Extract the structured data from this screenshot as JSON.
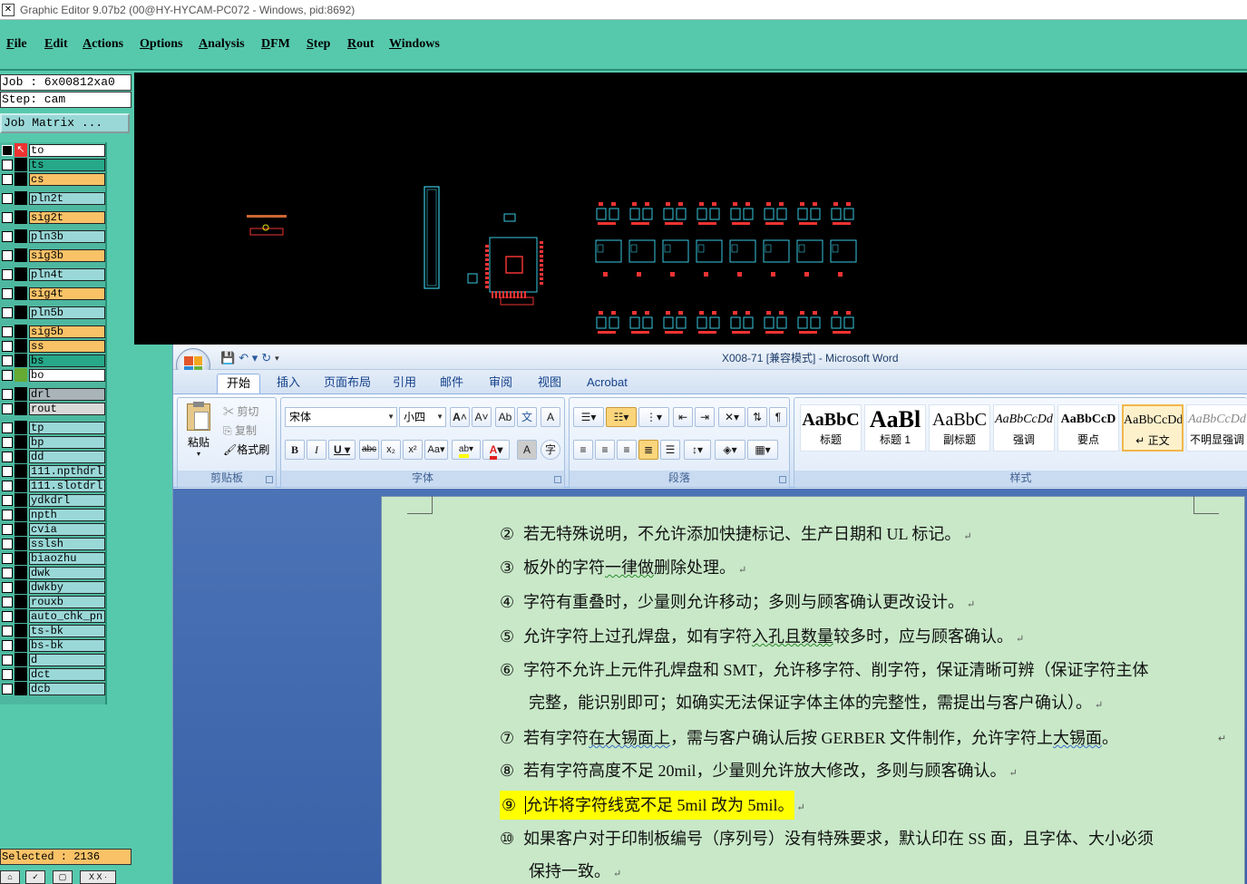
{
  "genesis": {
    "title": "Graphic Editor 9.07b2 (00@HY-HYCAM-PC072 - Windows, pid:8692)",
    "menu": [
      {
        "label": "File",
        "u": "F",
        "rest": "ile"
      },
      {
        "label": "Edit",
        "u": "E",
        "rest": "dit"
      },
      {
        "label": "Actions",
        "u": "A",
        "rest": "ctions"
      },
      {
        "label": "Options",
        "u": "O",
        "rest": "ptions"
      },
      {
        "label": "Analysis",
        "u": "A",
        "rest": "nalysis"
      },
      {
        "label": "DFM",
        "u": "D",
        "rest": "FM"
      },
      {
        "label": "Step",
        "u": "S",
        "rest": "tep"
      },
      {
        "label": "Rout",
        "u": "R",
        "rest": "out"
      },
      {
        "label": "Windows",
        "u": "W",
        "rest": "indows"
      }
    ],
    "job": "Job : 6x00812xa0",
    "step": "Step: cam",
    "job_matrix": "Job Matrix ...",
    "selected": "Selected : 2136",
    "layers": [
      {
        "name": "to",
        "color": "#ffffff"
      },
      {
        "name": "ts",
        "color": "#26a889"
      },
      {
        "name": "cs",
        "color": "#f9c267"
      },
      {
        "name": "pln2t",
        "color": "#9ad8d8"
      },
      {
        "name": "sig2t",
        "color": "#f9c267"
      },
      {
        "name": "pln3b",
        "color": "#9ad8d8"
      },
      {
        "name": "sig3b",
        "color": "#f9c267"
      },
      {
        "name": "pln4t",
        "color": "#9ad8d8"
      },
      {
        "name": "sig4t",
        "color": "#f9c267"
      },
      {
        "name": "pln5b",
        "color": "#9ad8d8"
      },
      {
        "name": "sig5b",
        "color": "#f9c267"
      },
      {
        "name": "ss",
        "color": "#f9c267"
      },
      {
        "name": "bs",
        "color": "#26a889"
      },
      {
        "name": "bo",
        "color": "#ffffff"
      },
      {
        "name": "drl",
        "color": "#a8b4b8"
      },
      {
        "name": "rout",
        "color": "#d9d9d9"
      },
      {
        "name": "tp",
        "color": "#9ad8d8"
      },
      {
        "name": "bp",
        "color": "#9ad8d8"
      },
      {
        "name": "dd",
        "color": "#9ad8d8"
      },
      {
        "name": "111.npthdrl",
        "color": "#9ad8d8"
      },
      {
        "name": "111.slotdrl",
        "color": "#9ad8d8"
      },
      {
        "name": "ydkdrl",
        "color": "#9ad8d8"
      },
      {
        "name": "npth",
        "color": "#9ad8d8"
      },
      {
        "name": "cvia",
        "color": "#9ad8d8"
      },
      {
        "name": "sslsh",
        "color": "#9ad8d8"
      },
      {
        "name": "biaozhu",
        "color": "#9ad8d8"
      },
      {
        "name": "dwk",
        "color": "#9ad8d8"
      },
      {
        "name": "dwkby",
        "color": "#9ad8d8"
      },
      {
        "name": "rouxb",
        "color": "#9ad8d8"
      },
      {
        "name": "auto_chk_pn",
        "color": "#9ad8d8"
      },
      {
        "name": "ts-bk",
        "color": "#9ad8d8"
      },
      {
        "name": "bs-bk",
        "color": "#9ad8d8"
      },
      {
        "name": "d",
        "color": "#9ad8d8"
      },
      {
        "name": "dct",
        "color": "#9ad8d8"
      },
      {
        "name": "dcb",
        "color": "#9ad8d8"
      }
    ]
  },
  "word": {
    "title": "X008-71 [兼容模式] - Microsoft Word",
    "tabs": [
      "开始",
      "插入",
      "页面布局",
      "引用",
      "邮件",
      "审阅",
      "视图",
      "Acrobat"
    ],
    "clipboard": {
      "paste": "粘贴",
      "cut": "剪切",
      "copy": "复制",
      "format_painter": "格式刷",
      "label": "剪贴板"
    },
    "font": {
      "name": "宋体",
      "size": "小四",
      "label": "字体"
    },
    "paragraph": {
      "label": "段落"
    },
    "styles": {
      "label": "样式",
      "items": [
        {
          "sample": "AaBbC",
          "name": "标题"
        },
        {
          "sample": "AaBl",
          "name": "标题 1"
        },
        {
          "sample": "AaBbC",
          "name": "副标题"
        },
        {
          "sample": "AaBbCcDd",
          "name": "强调"
        },
        {
          "sample": "AaBbCcD",
          "name": "要点"
        },
        {
          "sample": "AaBbCcDd",
          "name": "↵ 正文"
        },
        {
          "sample": "AaBbCcDd",
          "name": "不明显强调"
        }
      ]
    },
    "doc": {
      "p2": {
        "num": "②",
        "text": "若无特殊说明，不允许添加快捷标记、生产日期和 UL 标记。"
      },
      "p3": {
        "num": "③",
        "a": "板外的字符",
        "b": "一律做",
        "c": "删除处理。"
      },
      "p4": {
        "num": "④",
        "text": "字符有重叠时，少量则允许移动；多则与顾客确认更改设计。"
      },
      "p5": {
        "num": "⑤",
        "a": "允许字符上过孔焊盘，如有字符",
        "b": "入孔且数量",
        "c": "较多时，应与顾客确认。"
      },
      "p6": {
        "num": "⑥",
        "text": "字符不允许上元件孔焊盘和 SMT，允许移字符、削字符，保证清晰可辨（保证字符主体",
        "cont": "完整，能识别即可；如确实无法保证字体主体的完整性，需提出与客户确认）。"
      },
      "p7": {
        "num": "⑦",
        "a": "若有字符",
        "b": "在大锡面上",
        "c": "，需与客户确认后按 GERBER 文件制作，允许字符上",
        "d": "大锡面",
        "e": "。"
      },
      "p8": {
        "num": "⑧",
        "text": "若有字符高度不足 20mil，少量则允许放大修改，多则与顾客确认。"
      },
      "p9": {
        "num": "⑨",
        "text": "允许将字符线宽不足 5mil 改为 5mil。"
      },
      "p10": {
        "num": "⑩",
        "text": "如果客户对于印制板编号（序列号）没有特殊要求，默认印在 SS 面，且字体、大小必须",
        "cont": "保持一致。"
      }
    }
  }
}
